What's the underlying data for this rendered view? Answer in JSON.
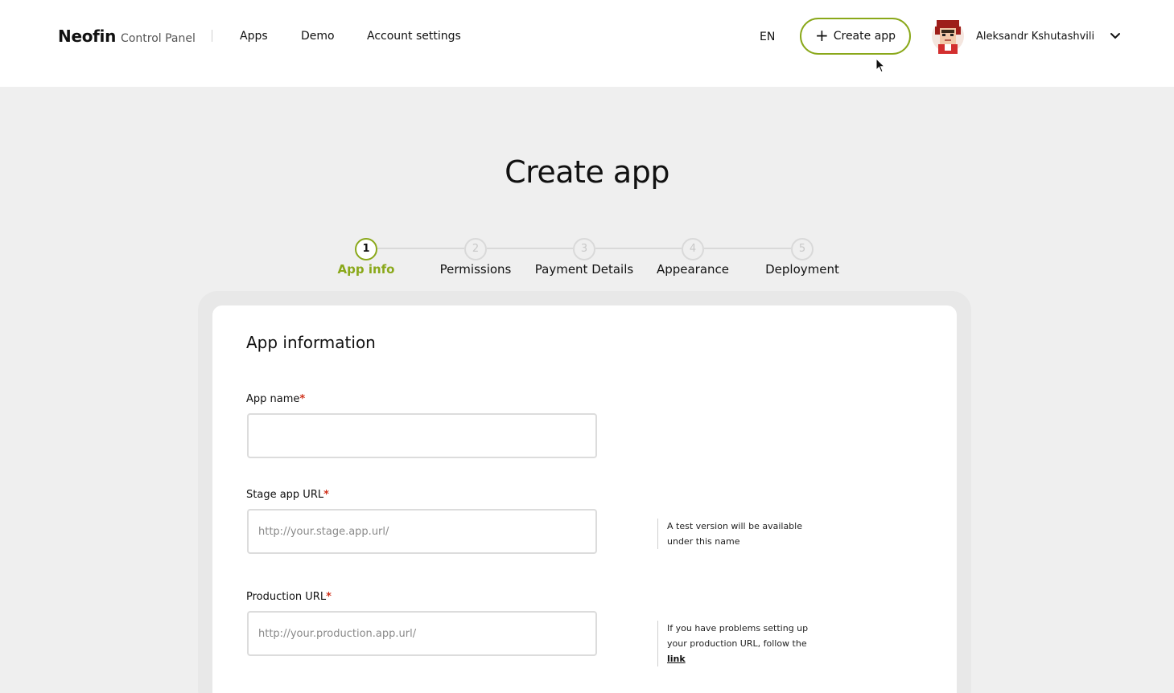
{
  "header": {
    "brand_name": "Neofin",
    "brand_sub": "Control Panel",
    "nav": [
      "Apps",
      "Demo",
      "Account settings"
    ],
    "language": "EN",
    "create_button": "Create app",
    "user_name": "Aleksandr Kshutashvili",
    "accent_color": "#8aa81a"
  },
  "page": {
    "title": "Create app"
  },
  "stepper": {
    "steps": [
      {
        "number": "1",
        "label": "App info",
        "active": true
      },
      {
        "number": "2",
        "label": "Permissions",
        "active": false
      },
      {
        "number": "3",
        "label": "Payment Details",
        "active": false
      },
      {
        "number": "4",
        "label": "Appearance",
        "active": false
      },
      {
        "number": "5",
        "label": "Deployment",
        "active": false
      }
    ]
  },
  "form": {
    "section_title": "App information",
    "required_mark": "*",
    "fields": [
      {
        "label": "App name",
        "value": "",
        "placeholder": ""
      },
      {
        "label": "Stage app URL",
        "value": "",
        "placeholder": "http://your.stage.app.url/",
        "hint": "A test version will be available under this name"
      },
      {
        "label": "Production URL",
        "value": "",
        "placeholder": "http://your.production.app.url/",
        "hint": "If you have problems setting up your production URL, follow the",
        "hint_link": "link"
      }
    ]
  }
}
